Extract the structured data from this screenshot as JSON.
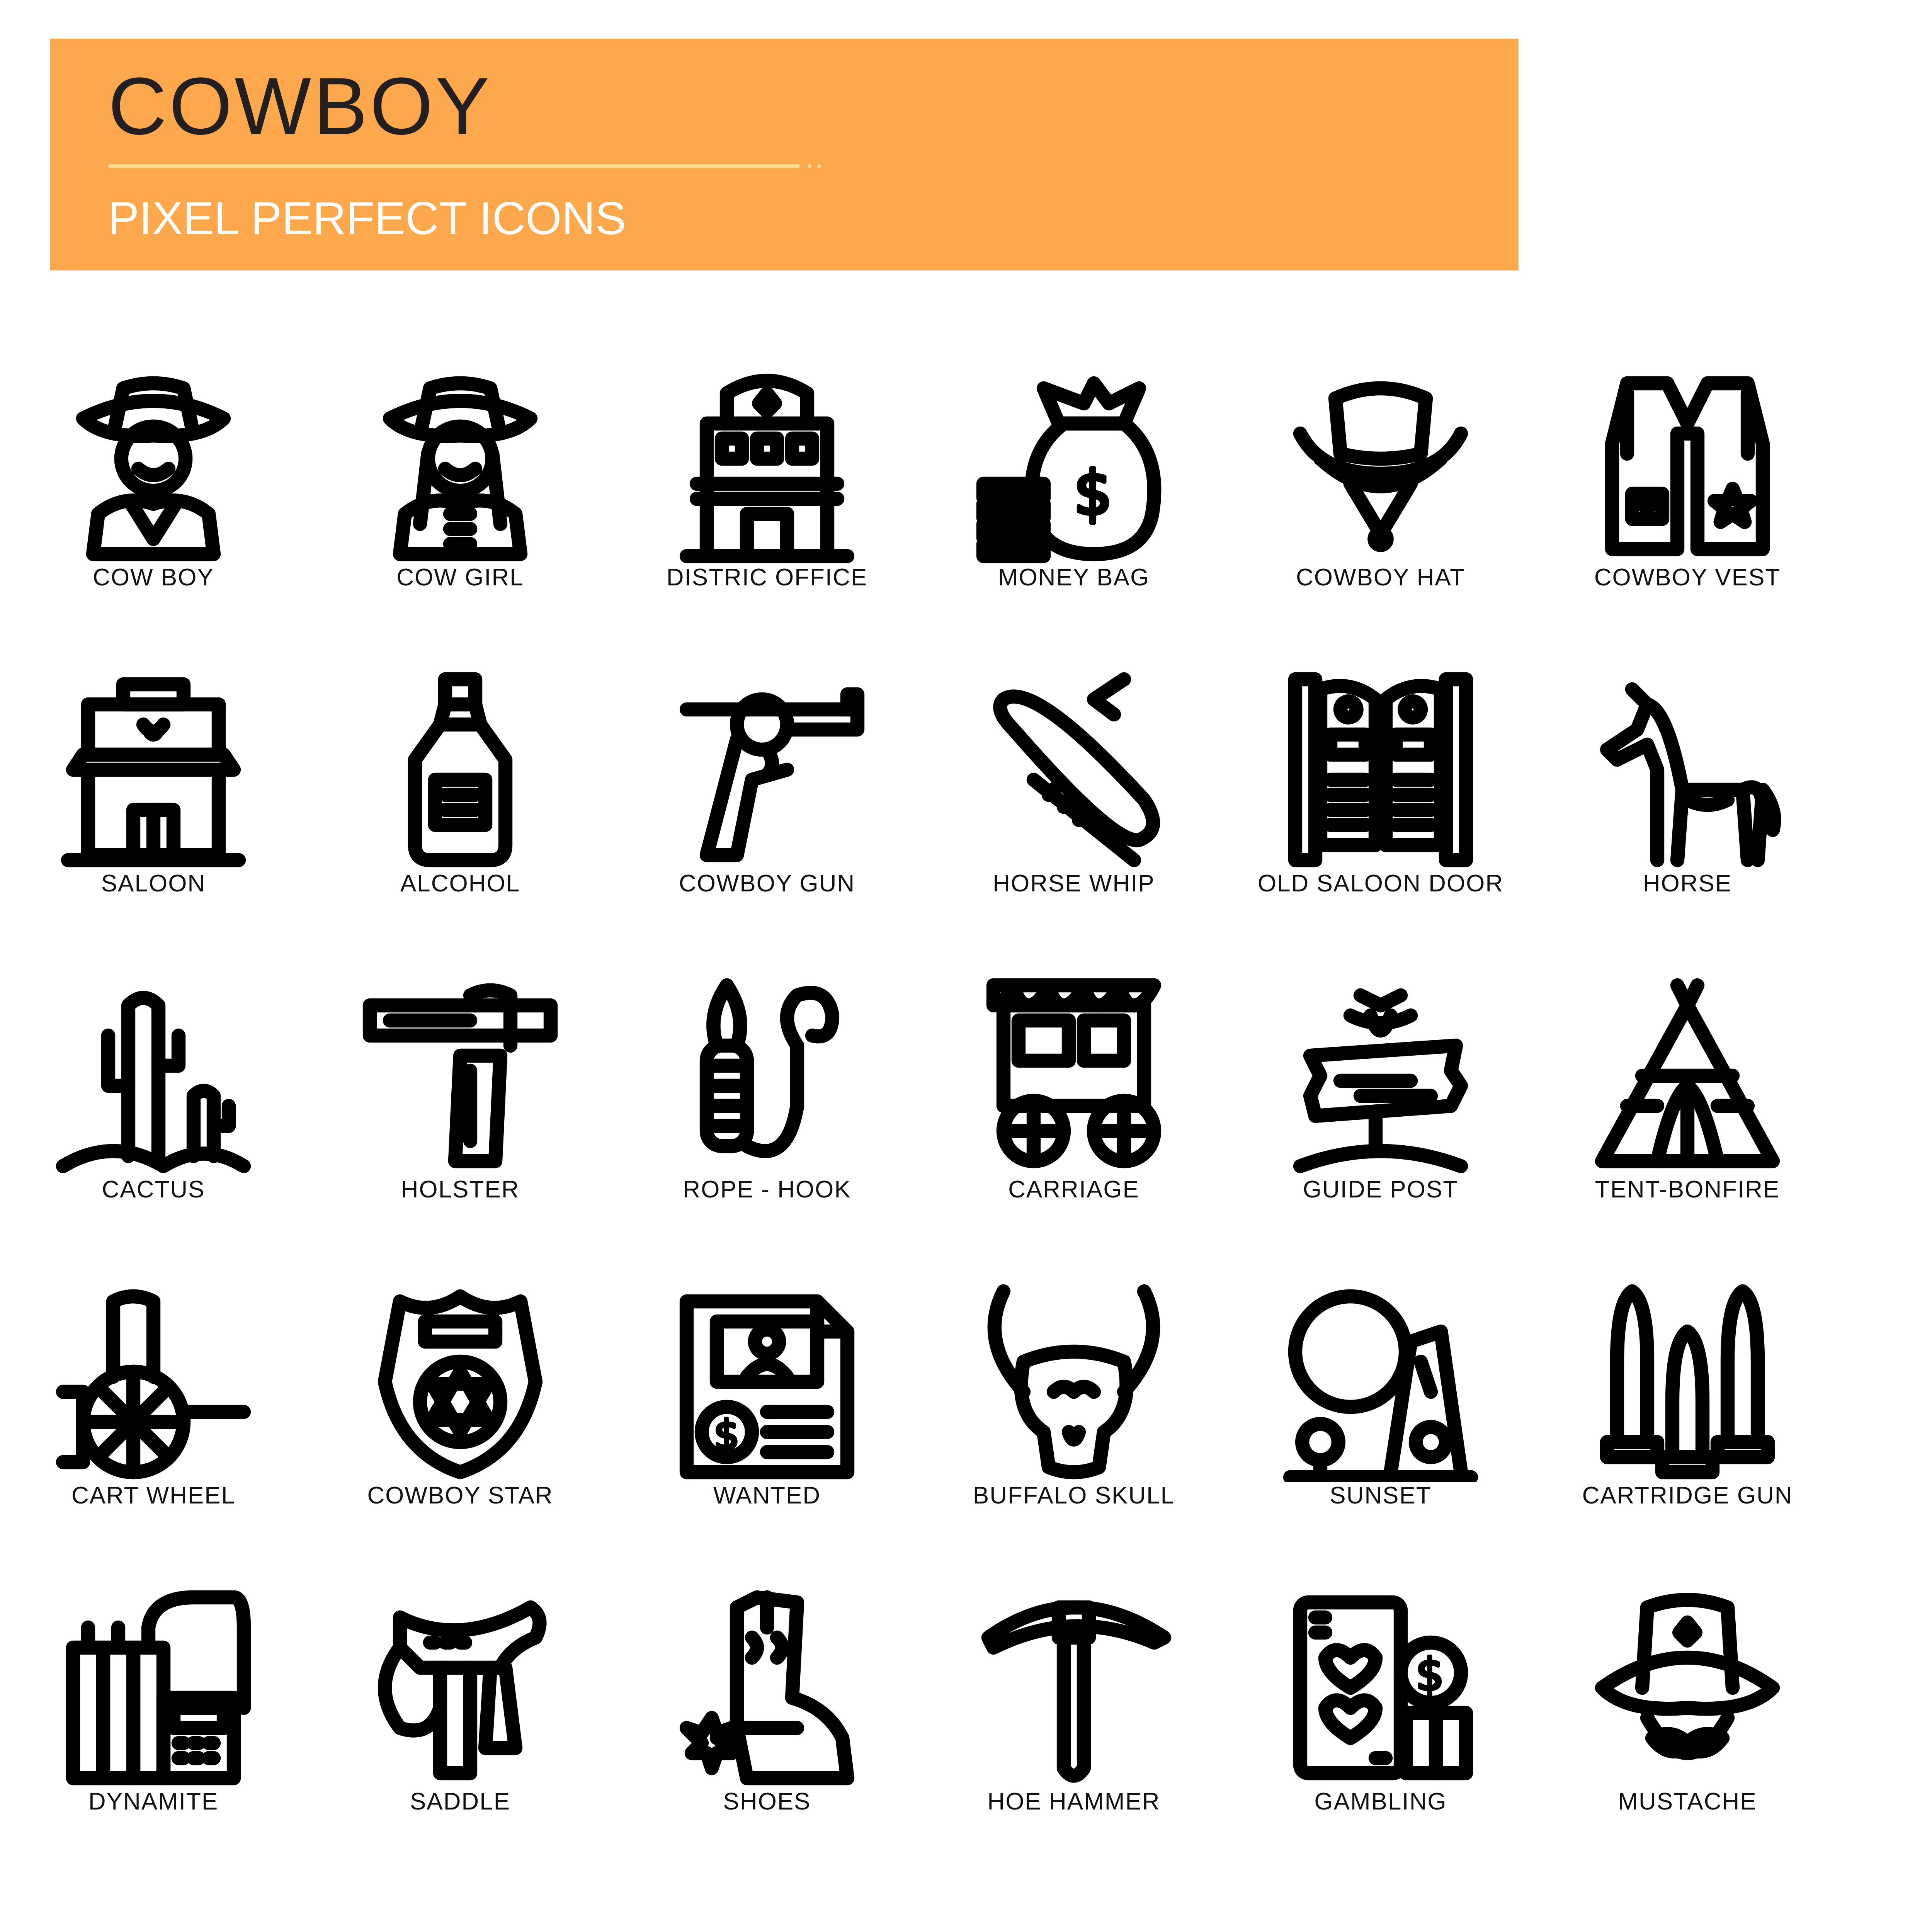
{
  "header": {
    "title": "COWBOY",
    "subtitle": "PIXEL PERFECT ICONS",
    "banner_color": "#fea84d",
    "divider_color": "#ffd98f"
  },
  "icons": [
    {
      "label": "COW BOY",
      "icon": "cowboy-icon"
    },
    {
      "label": "COW GIRL",
      "icon": "cowgirl-icon"
    },
    {
      "label": "DISTRIC OFFICE",
      "icon": "district-office-icon"
    },
    {
      "label": "MONEY BAG",
      "icon": "money-bag-icon"
    },
    {
      "label": "COWBOY HAT",
      "icon": "cowboy-hat-icon"
    },
    {
      "label": "COWBOY VEST",
      "icon": "cowboy-vest-icon"
    },
    {
      "label": "SALOON",
      "icon": "saloon-icon"
    },
    {
      "label": "ALCOHOL",
      "icon": "alcohol-bottle-icon"
    },
    {
      "label": "COWBOY GUN",
      "icon": "revolver-icon"
    },
    {
      "label": "HORSE WHIP",
      "icon": "horse-whip-icon"
    },
    {
      "label": "OLD SALOON DOOR",
      "icon": "saloon-door-icon"
    },
    {
      "label": "HORSE",
      "icon": "horse-icon"
    },
    {
      "label": "CACTUS",
      "icon": "cactus-icon"
    },
    {
      "label": "HOLSTER",
      "icon": "holster-icon"
    },
    {
      "label": "ROPE - HOOK",
      "icon": "rope-hook-icon"
    },
    {
      "label": "CARRIAGE",
      "icon": "carriage-icon"
    },
    {
      "label": "GUIDE POST",
      "icon": "guide-post-icon"
    },
    {
      "label": "TENT-BONFIRE",
      "icon": "tent-icon"
    },
    {
      "label": "CART WHEEL",
      "icon": "cart-wheel-icon"
    },
    {
      "label": "COWBOY STAR",
      "icon": "sheriff-badge-icon"
    },
    {
      "label": "WANTED",
      "icon": "wanted-poster-icon"
    },
    {
      "label": "BUFFALO SKULL",
      "icon": "buffalo-skull-icon"
    },
    {
      "label": "SUNSET",
      "icon": "sunset-icon"
    },
    {
      "label": "CARTRIDGE GUN",
      "icon": "cartridge-icon"
    },
    {
      "label": "DYNAMITE",
      "icon": "dynamite-icon"
    },
    {
      "label": "SADDLE",
      "icon": "saddle-icon"
    },
    {
      "label": "SHOES",
      "icon": "cowboy-boot-icon"
    },
    {
      "label": "HOE HAMMER",
      "icon": "pickaxe-icon"
    },
    {
      "label": "GAMBLING",
      "icon": "gambling-icon"
    },
    {
      "label": "MUSTACHE",
      "icon": "mustache-icon"
    }
  ]
}
